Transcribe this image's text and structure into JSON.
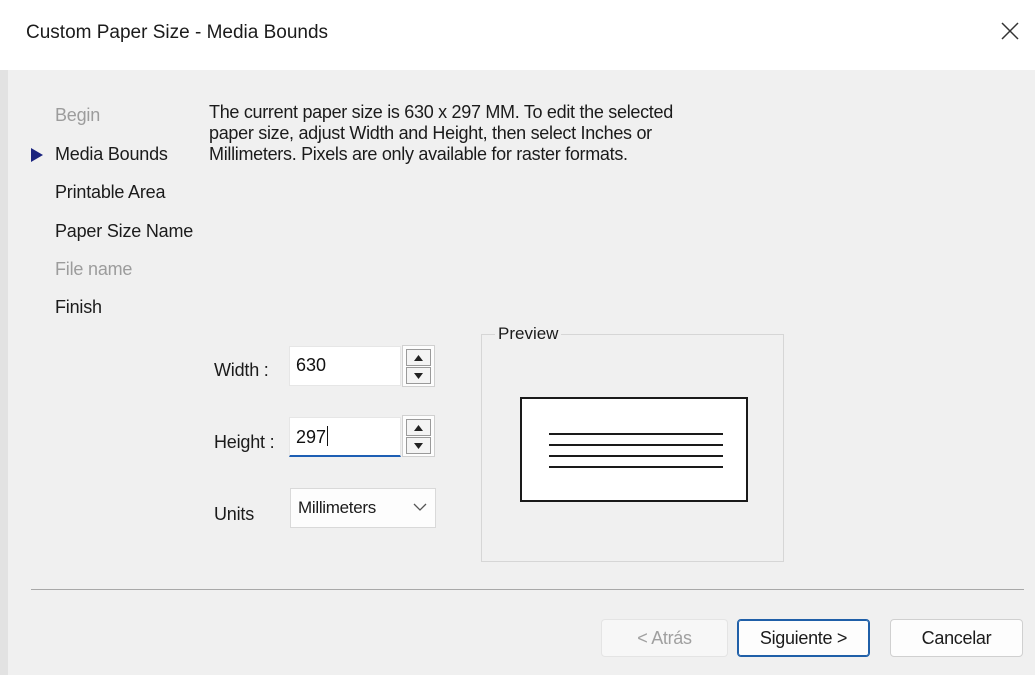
{
  "window": {
    "title": "Custom Paper Size - Media Bounds",
    "close_icon": "close-icon"
  },
  "steps": [
    {
      "label": "Begin",
      "enabled": false
    },
    {
      "label": "Media Bounds",
      "enabled": true,
      "current": true
    },
    {
      "label": "Printable Area",
      "enabled": true
    },
    {
      "label": "Paper Size Name",
      "enabled": true
    },
    {
      "label": "File name",
      "enabled": false
    },
    {
      "label": "Finish",
      "enabled": true
    }
  ],
  "description": {
    "line1": "The current paper size is 630 x 297 MM. To edit the selected",
    "line2": "paper size, adjust Width and Height, then select Inches or",
    "line3": "Millimeters. Pixels are only available for raster formats."
  },
  "form": {
    "width_label": "Width :",
    "width_value": "630",
    "height_label": "Height :",
    "height_value": "297",
    "units_label": "Units",
    "units_value": "Millimeters"
  },
  "preview": {
    "label": "Preview"
  },
  "buttons": {
    "back": "< Atrás",
    "next": "Siguiente >",
    "cancel": "Cancelar"
  },
  "colors": {
    "accent": "#1e5fb4",
    "disabled_text": "#9c9c9c",
    "dialog_bg": "#f0f0f0"
  }
}
